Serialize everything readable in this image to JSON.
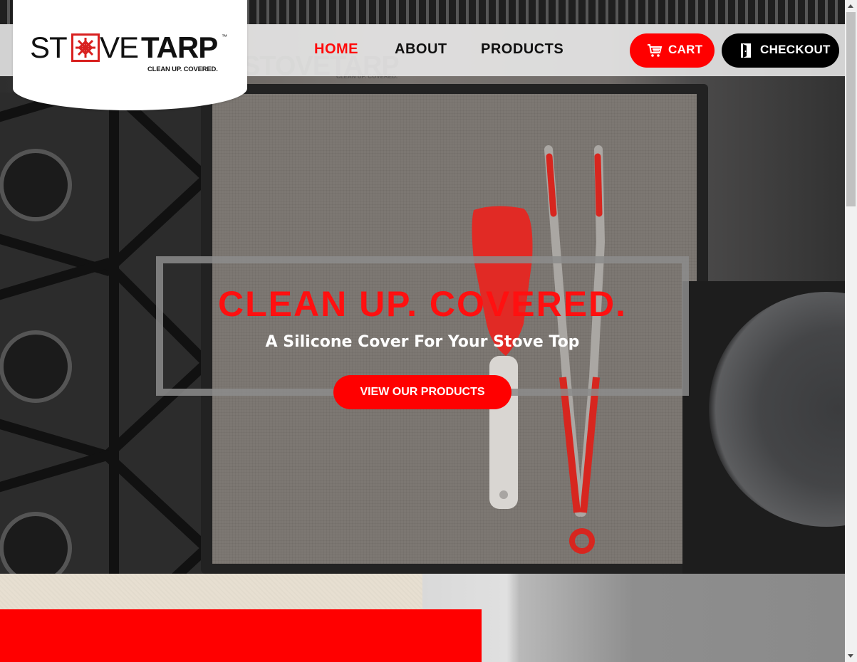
{
  "brand": {
    "logo_text_a": "ST",
    "logo_text_mid": "VE",
    "logo_text_b": "TARP",
    "trademark": "™",
    "tagline": "CLEAN UP. COVERED."
  },
  "nav": {
    "items": [
      {
        "label": "HOME",
        "active": true
      },
      {
        "label": "ABOUT",
        "active": false
      },
      {
        "label": "PRODUCTS",
        "active": false
      }
    ]
  },
  "actions": {
    "cart_label": "CART",
    "checkout_label": "CHECKOUT"
  },
  "hero": {
    "headline": "CLEAN UP. COVERED.",
    "subheadline": "A Silicone Cover For Your Stove Top",
    "cta_label": "VIEW OUR PRODUCTS"
  },
  "colors": {
    "accent_red": "#ff0000",
    "dark": "#000000",
    "header_bg": "#eeeeee",
    "lower_tan": "#e7dfd1"
  },
  "icons": {
    "cart": "shopping-cart-icon",
    "checkout": "door-exit-icon",
    "logo_emblem": "snowflake-tile-icon"
  }
}
